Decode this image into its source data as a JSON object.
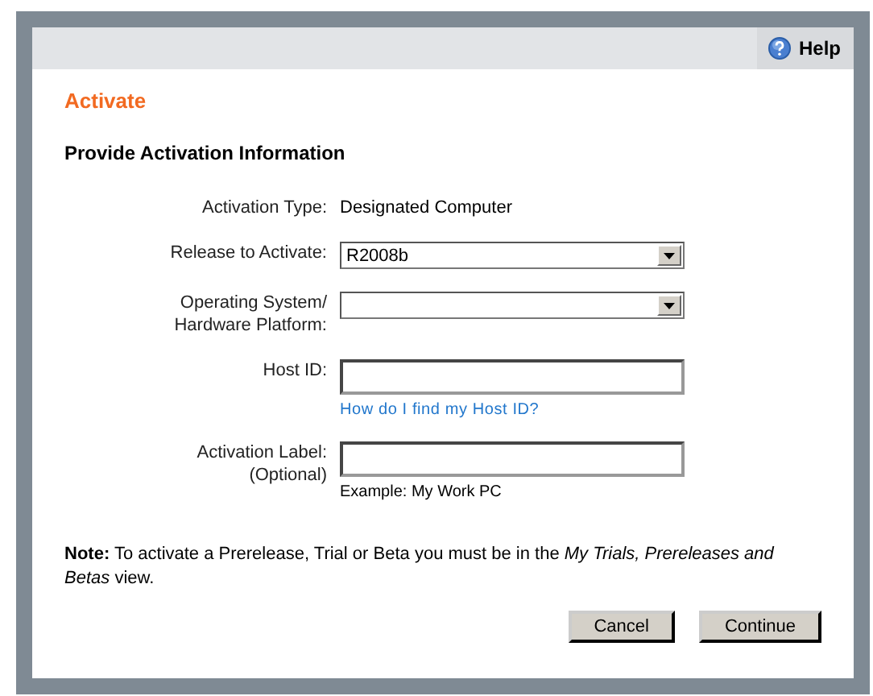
{
  "help": {
    "label": "Help"
  },
  "title": "Activate",
  "heading": "Provide Activation Information",
  "fields": [
    {
      "kind": "text",
      "label": "Activation Type:",
      "value": "Designated Computer"
    },
    {
      "kind": "select",
      "label": "Release to Activate:",
      "value": "R2008b"
    },
    {
      "kind": "select",
      "label": "Operating System/\nHardware Platform:"
    },
    {
      "kind": "input",
      "label": "Host ID:",
      "link": "How do I find my Host ID?"
    },
    {
      "kind": "input",
      "label": "Activation Label:\n(Optional)",
      "hint": "Example: My Work PC"
    }
  ],
  "note": "**Note:** To activate a Prerelease, Trial or Beta you must be in the *My Trials, Prereleases and Betas* view.",
  "buttons": [
    "Cancel",
    "Continue"
  ]
}
